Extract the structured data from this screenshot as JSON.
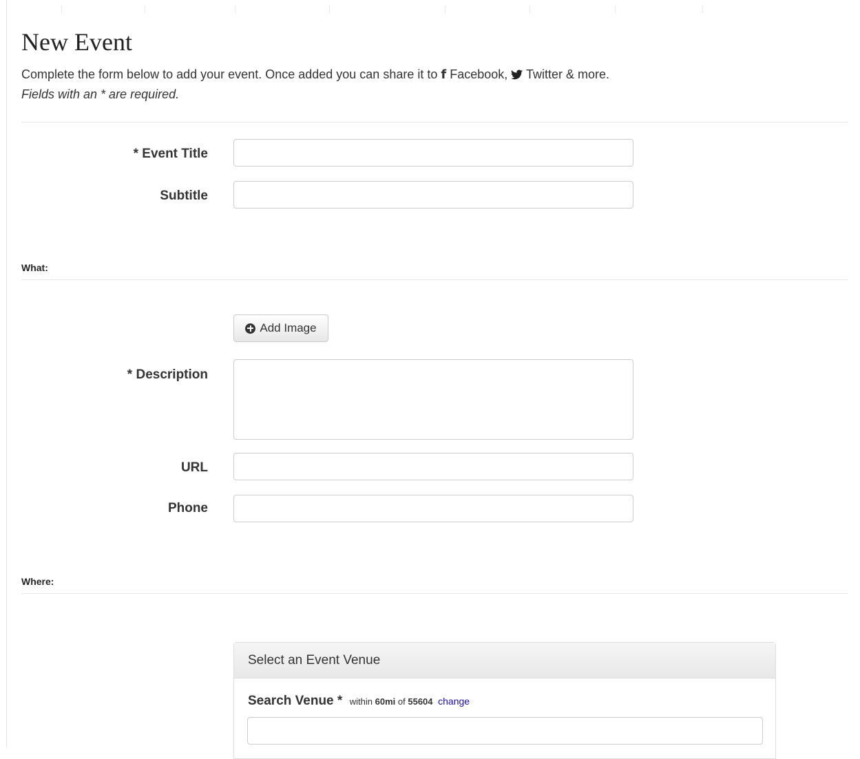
{
  "page": {
    "title": "New Event",
    "intro_text": "Complete the form below to add your event. Once added you can share it to",
    "facebook_label": "Facebook,",
    "twitter_label": "Twitter & more.",
    "required_note": "Fields with an * are required."
  },
  "icons": {
    "facebook": "facebook-icon",
    "twitter": "twitter-icon",
    "add": "plus-circle-icon"
  },
  "form": {
    "event_title_label": "* Event Title",
    "event_title_value": "",
    "subtitle_label": "Subtitle",
    "subtitle_value": "",
    "what_section": "What:",
    "add_image_label": "Add Image",
    "description_label": "* Description",
    "description_value": "",
    "url_label": "URL",
    "url_value": "",
    "phone_label": "Phone",
    "phone_value": "",
    "where_section": "Where:"
  },
  "venue": {
    "panel_title": "Select an Event Venue",
    "search_label": "Search Venue *",
    "within_prefix": "within",
    "distance": "60mi",
    "of_word": "of",
    "zip": "55604",
    "change_link": "change",
    "search_value": ""
  }
}
